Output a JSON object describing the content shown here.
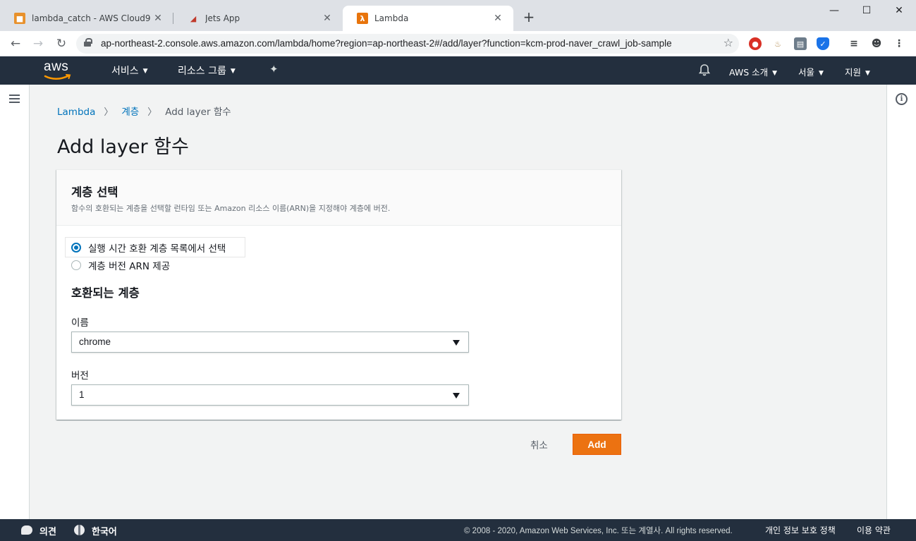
{
  "browser": {
    "tabs": [
      {
        "title": "lambda_catch - AWS Cloud9",
        "icon": "cloud9-cube-icon",
        "active": false
      },
      {
        "title": "Jets App",
        "icon": "jets-icon",
        "active": false
      },
      {
        "title": "Lambda",
        "icon": "lambda-icon",
        "active": true
      }
    ],
    "new_tab_glyph": "+",
    "url": "ap-northeast-2.console.aws.amazon.com/lambda/home?region=ap-northeast-2#/add/layer?function=kcm-prod-naver_crawl_job-sample"
  },
  "aws_nav": {
    "logo": "aws",
    "services": "서비스",
    "resource_groups": "리소스 그룹",
    "about": "AWS 소개",
    "region": "서울",
    "support": "지원"
  },
  "breadcrumb": {
    "root": "Lambda",
    "layers": "계층",
    "current": "Add layer 함수"
  },
  "page": {
    "title": "Add layer 함수"
  },
  "panel": {
    "title": "계층 선택",
    "description": "함수의 호환되는 계층을 선택할 런타임 또는 Amazon 리소스 이름(ARN)을 지정해야 계층에 버전.",
    "option_runtime": "실행 시간 호환 계층 목록에서 선택",
    "option_arn": "계층 버전 ARN 제공",
    "section_title": "호환되는 계층",
    "name_label": "이름",
    "name_value": "chrome",
    "version_label": "버전",
    "version_value": "1"
  },
  "actions": {
    "cancel": "취소",
    "add": "Add"
  },
  "footer": {
    "feedback": "의견",
    "language": "한국어",
    "copyright": "© 2008 - 2020, Amazon Web Services, Inc. 또는 계열사. All rights reserved.",
    "privacy": "개인 정보 보호 정책",
    "terms": "이용 약관"
  },
  "colors": {
    "aws_nav": "#232f3e",
    "primary_button": "#ec7211",
    "link": "#0073bb"
  }
}
